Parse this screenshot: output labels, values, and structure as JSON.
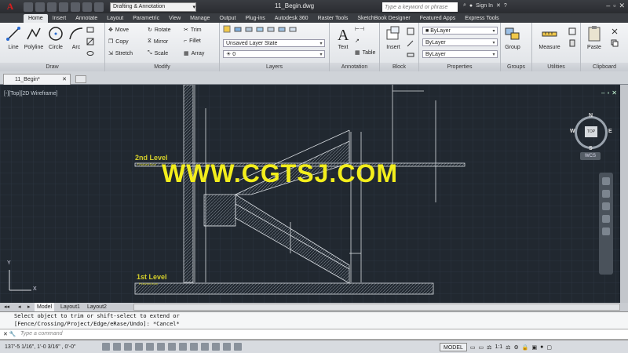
{
  "title": {
    "doc_name": "11_Begin.dwg",
    "workspace": "Drafting & Annotation",
    "search_placeholder": "Type a keyword or phrase",
    "sign_in": "Sign In"
  },
  "tabs": [
    "Home",
    "Insert",
    "Annotate",
    "Layout",
    "Parametric",
    "View",
    "Manage",
    "Output",
    "Plug-ins",
    "Autodesk 360",
    "Raster Tools",
    "SketchBook Designer",
    "Featured Apps",
    "Express Tools"
  ],
  "ribbon": {
    "draw": {
      "title": "Draw",
      "line": "Line",
      "polyline": "Polyline",
      "circle": "Circle",
      "arc": "Arc"
    },
    "modify": {
      "title": "Modify",
      "move": "Move",
      "rotate": "Rotate",
      "trim": "Trim",
      "copy": "Copy",
      "mirror": "Mirror",
      "fillet": "Fillet",
      "stretch": "Stretch",
      "scale": "Scale",
      "array": "Array"
    },
    "layers": {
      "title": "Layers",
      "state": "Unsaved Layer State",
      "current": "0"
    },
    "annotation": {
      "title": "Annotation",
      "text": "Text",
      "table": "Table"
    },
    "block": {
      "title": "Block",
      "insert": "Insert"
    },
    "properties": {
      "title": "Properties",
      "color": "ByLayer",
      "linetype": "ByLayer",
      "lineweight": "ByLayer"
    },
    "groups": {
      "title": "Groups",
      "group": "Group"
    },
    "utilities": {
      "title": "Utilities",
      "measure": "Measure"
    },
    "clipboard": {
      "title": "Clipboard",
      "paste": "Paste"
    }
  },
  "doc_tab": "11_Begin*",
  "viewport": {
    "label": "[-][Top][2D Wireframe]",
    "compass": {
      "n": "N",
      "s": "S",
      "e": "E",
      "w": "W",
      "top": "TOP"
    },
    "wcs": "WCS"
  },
  "drawing": {
    "level2": "2nd Level",
    "level2_sub": "Finished floor",
    "level1": "1st Level",
    "level1_sub": "Finished floor",
    "watermark": "WWW.CGTSJ.COM"
  },
  "layout_tabs": [
    "Model",
    "Layout1",
    "Layout2"
  ],
  "command": {
    "line1": "Select object to trim or shift-select to extend or",
    "line2": "[Fence/Crossing/Project/Edge/eRase/Undo]: *Cancel*",
    "placeholder": "Type a command"
  },
  "status": {
    "coords": "137'-5 1/16\", 1'-0 3/16\" , 0'-0\"",
    "model": "MODEL",
    "scale": "1:1"
  },
  "colors": {
    "canvas": "#212830",
    "grid": "#2c3540",
    "geometry": "#d9dde2",
    "level_text": "#d4cf2a",
    "watermark": "#f3ee1c"
  }
}
